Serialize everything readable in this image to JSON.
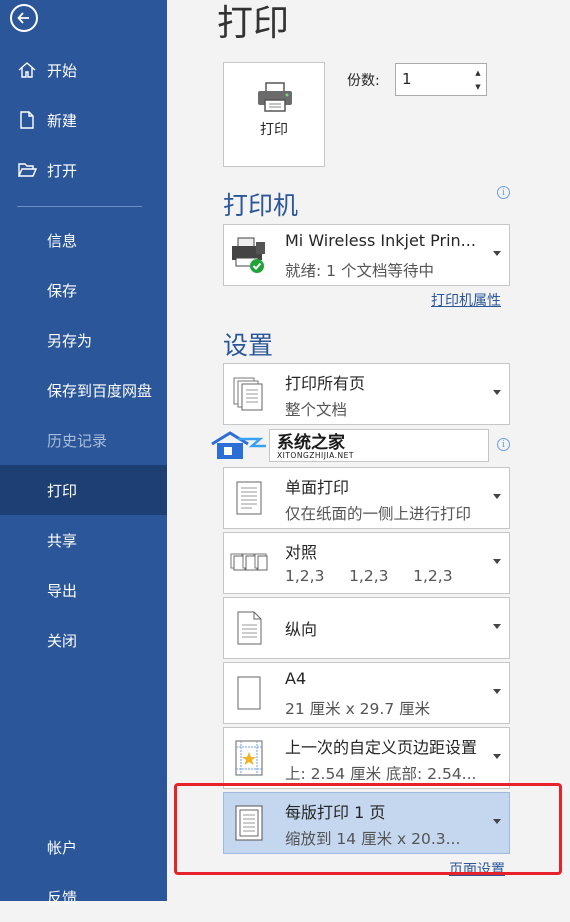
{
  "sidebar": {
    "items": [
      {
        "label": "开始",
        "icon": "home-icon"
      },
      {
        "label": "新建",
        "icon": "new-document-icon"
      },
      {
        "label": "打开",
        "icon": "open-folder-icon"
      },
      {
        "label": "信息"
      },
      {
        "label": "保存"
      },
      {
        "label": "另存为"
      },
      {
        "label": "保存到百度网盘"
      },
      {
        "label": "历史记录"
      },
      {
        "label": "打印"
      },
      {
        "label": "共享"
      },
      {
        "label": "导出"
      },
      {
        "label": "关闭"
      }
    ],
    "bottom": [
      {
        "label": "帐户"
      },
      {
        "label": "反馈"
      }
    ]
  },
  "main": {
    "title": "打印",
    "print_button": "打印",
    "copies": {
      "label": "份数:",
      "value": "1"
    },
    "printer_section": "打印机",
    "printer": {
      "name": "Mi Wireless Inkjet Prin...",
      "status": "就绪: 1 个文档等待中"
    },
    "printer_props_link": "打印机属性",
    "settings_section": "设置",
    "settings": [
      {
        "l1": "打印所有页",
        "l2": "整个文档",
        "icon": "pages-icon"
      },
      {
        "l1": "单面打印",
        "l2": "仅在纸面的一侧上进行打印",
        "icon": "single-sided-icon"
      },
      {
        "l1": "对照",
        "l2": "1,2,3     1,2,3     1,2,3",
        "icon": "collate-icon"
      },
      {
        "l1": "纵向",
        "icon": "portrait-icon"
      },
      {
        "l1": "A4",
        "l2": "21 厘米 x 29.7 厘米",
        "icon": "paper-size-icon"
      },
      {
        "l1": "上一次的自定义页边距设置",
        "l2": "上: 2.54 厘米 底部: 2.54...",
        "icon": "margins-icon"
      },
      {
        "l1": "每版打印 1 页",
        "l2": "缩放到 14 厘米 x 20.3...",
        "icon": "pages-per-sheet-icon"
      }
    ],
    "page_setup_link": "页面设置",
    "watermark": {
      "title": "系统之家",
      "url": "XITONGZHIJIA.NET"
    }
  },
  "colors": {
    "sidebar": "#2b579a",
    "sidebar_active": "#1e3f73",
    "accent": "#2b579a",
    "selected": "#c5d7ef",
    "highlight": "#e8222a"
  }
}
